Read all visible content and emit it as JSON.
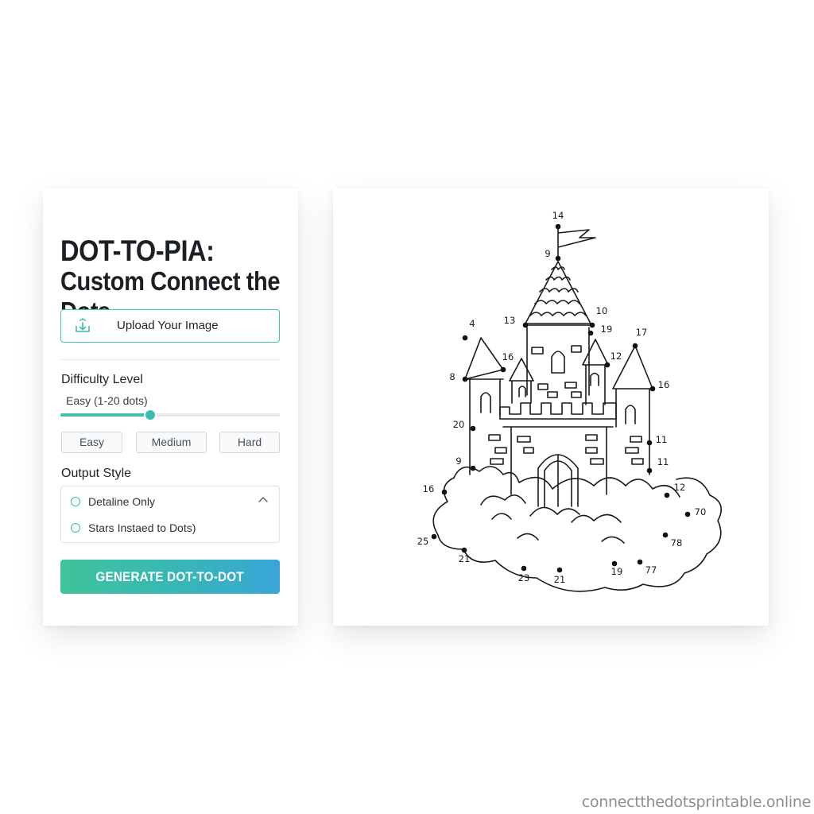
{
  "app": {
    "title_line1": "DOT-TO-PIA:",
    "title_line2": "Custom Connect the Dots"
  },
  "upload": {
    "label": "Upload Your Image",
    "icon": "upload-icon"
  },
  "difficulty": {
    "label": "Difficulty Level",
    "value_text": "Easy (1-20 dots)",
    "slider_fraction": 0.41,
    "options": [
      "Easy",
      "Medium",
      "Hard"
    ]
  },
  "output_style": {
    "label": "Output Style",
    "options": [
      "Detaline Only",
      "Stars Instaed to Dots)"
    ]
  },
  "generate": {
    "label": "GENERATE DOT-TO-DOT"
  },
  "preview": {
    "numbers": [
      "14",
      "9",
      "10",
      "19",
      "13",
      "4",
      "17",
      "16",
      "12",
      "8",
      "16",
      "20",
      "11",
      "9",
      "11",
      "16",
      "12",
      "70",
      "25",
      "78",
      "21",
      "19",
      "77",
      "23",
      "21"
    ]
  },
  "watermark": "connectthedotsprintable.online",
  "colors": {
    "accent": "#3fc0ad",
    "gradient_start": "#3fc49a",
    "gradient_end": "#3aa6d8"
  }
}
